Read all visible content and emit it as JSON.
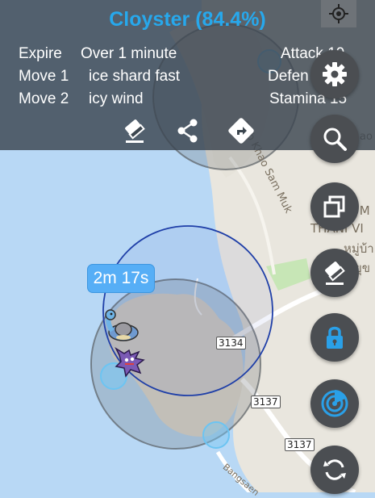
{
  "header": {
    "title": "Cloyster (84.4%)",
    "rows": [
      {
        "label": "Expire",
        "value": "Over 1 minute",
        "stat": "Attack 10"
      },
      {
        "label": "Move 1",
        "value": "ice shard fast",
        "stat": "Defen"
      },
      {
        "label": "Move 2",
        "value": "icy wind",
        "stat": "Stamina 15"
      }
    ],
    "actions": [
      "eraser-icon",
      "share-icon",
      "directions-icon"
    ]
  },
  "timer": "2m 17s",
  "map": {
    "roads": [
      "3134",
      "3137",
      "3137"
    ],
    "street_labels": [
      "Rob Khao Sam Muk",
      "Bangsaen"
    ],
    "place_labels": [
      "M M",
      "THANI VI",
      "หมู่บ้า",
      "ยุข",
      "ao"
    ]
  },
  "fabs": [
    "gear-icon",
    "search-icon",
    "layers-icon",
    "eraser-icon",
    "lock-icon",
    "radar-icon",
    "refresh-icon"
  ],
  "colors": {
    "accent": "#27a8ec",
    "fab": "#4b4e52",
    "water": "#b8d8f5",
    "land": "#e9e6de"
  }
}
